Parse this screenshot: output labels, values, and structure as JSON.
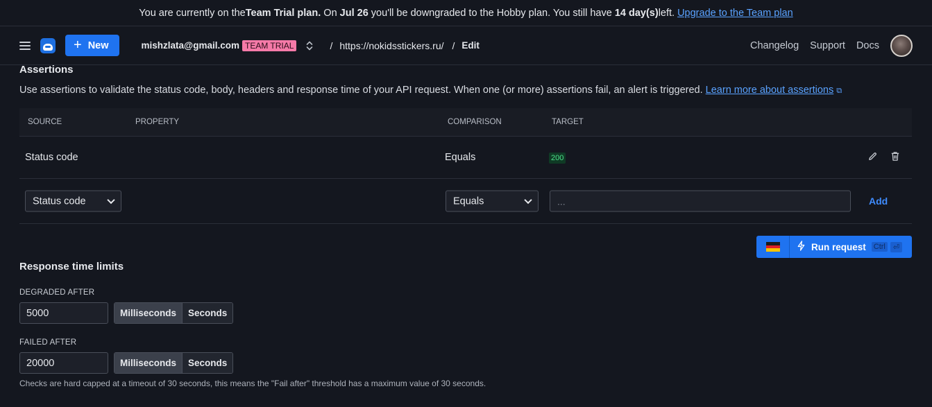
{
  "banner": {
    "p1": "You are currently on the ",
    "plan": "Team Trial plan.",
    "p2": " On ",
    "date": "Jul 26",
    "p3": " you'll be downgraded to the Hobby plan. You still have ",
    "days": "14 day(s)",
    "p4": " left.",
    "link": "Upgrade to the Team plan"
  },
  "topbar": {
    "new_label": "New",
    "account": "mishzlata@gmail.com",
    "plan_badge": "TEAM TRIAL",
    "crumb_sep": "/",
    "crumb_url": "https://nokidsstickers.ru/",
    "crumb_current": "Edit",
    "links": [
      "Changelog",
      "Support",
      "Docs"
    ]
  },
  "assertions": {
    "title": "Assertions",
    "description": "Use assertions to validate the status code, body, headers and response time of your API request. When one (or more) assertions fail, an alert is triggered.",
    "learn_more": "Learn more about assertions",
    "columns": [
      "SOURCE",
      "PROPERTY",
      "COMPARISON",
      "TARGET"
    ],
    "rows": [
      {
        "source": "Status code",
        "property": "",
        "comparison": "Equals",
        "target": "200"
      }
    ],
    "new_row": {
      "source_value": "Status code",
      "comparison_value": "Equals",
      "target_placeholder": "...",
      "add_label": "Add"
    }
  },
  "run": {
    "label": "Run request",
    "kbd1": "Ctrl",
    "kbd2": "⏎"
  },
  "response_time": {
    "title": "Response time limits",
    "degraded_label": "DEGRADED AFTER",
    "degraded_value": "5000",
    "failed_label": "FAILED AFTER",
    "failed_value": "20000",
    "unit_ms": "Milliseconds",
    "unit_s": "Seconds",
    "selected_unit": "Milliseconds",
    "hint": "Checks are hard capped at a timeout of 30 seconds, this means the \"Fail after\" threshold has a maximum value of 30 seconds."
  },
  "colors": {
    "background": "#14171f",
    "accent": "#1f73f0",
    "link": "#5aa2ff",
    "trial_badge": "#f57aa8",
    "success": "#4ee08a"
  }
}
